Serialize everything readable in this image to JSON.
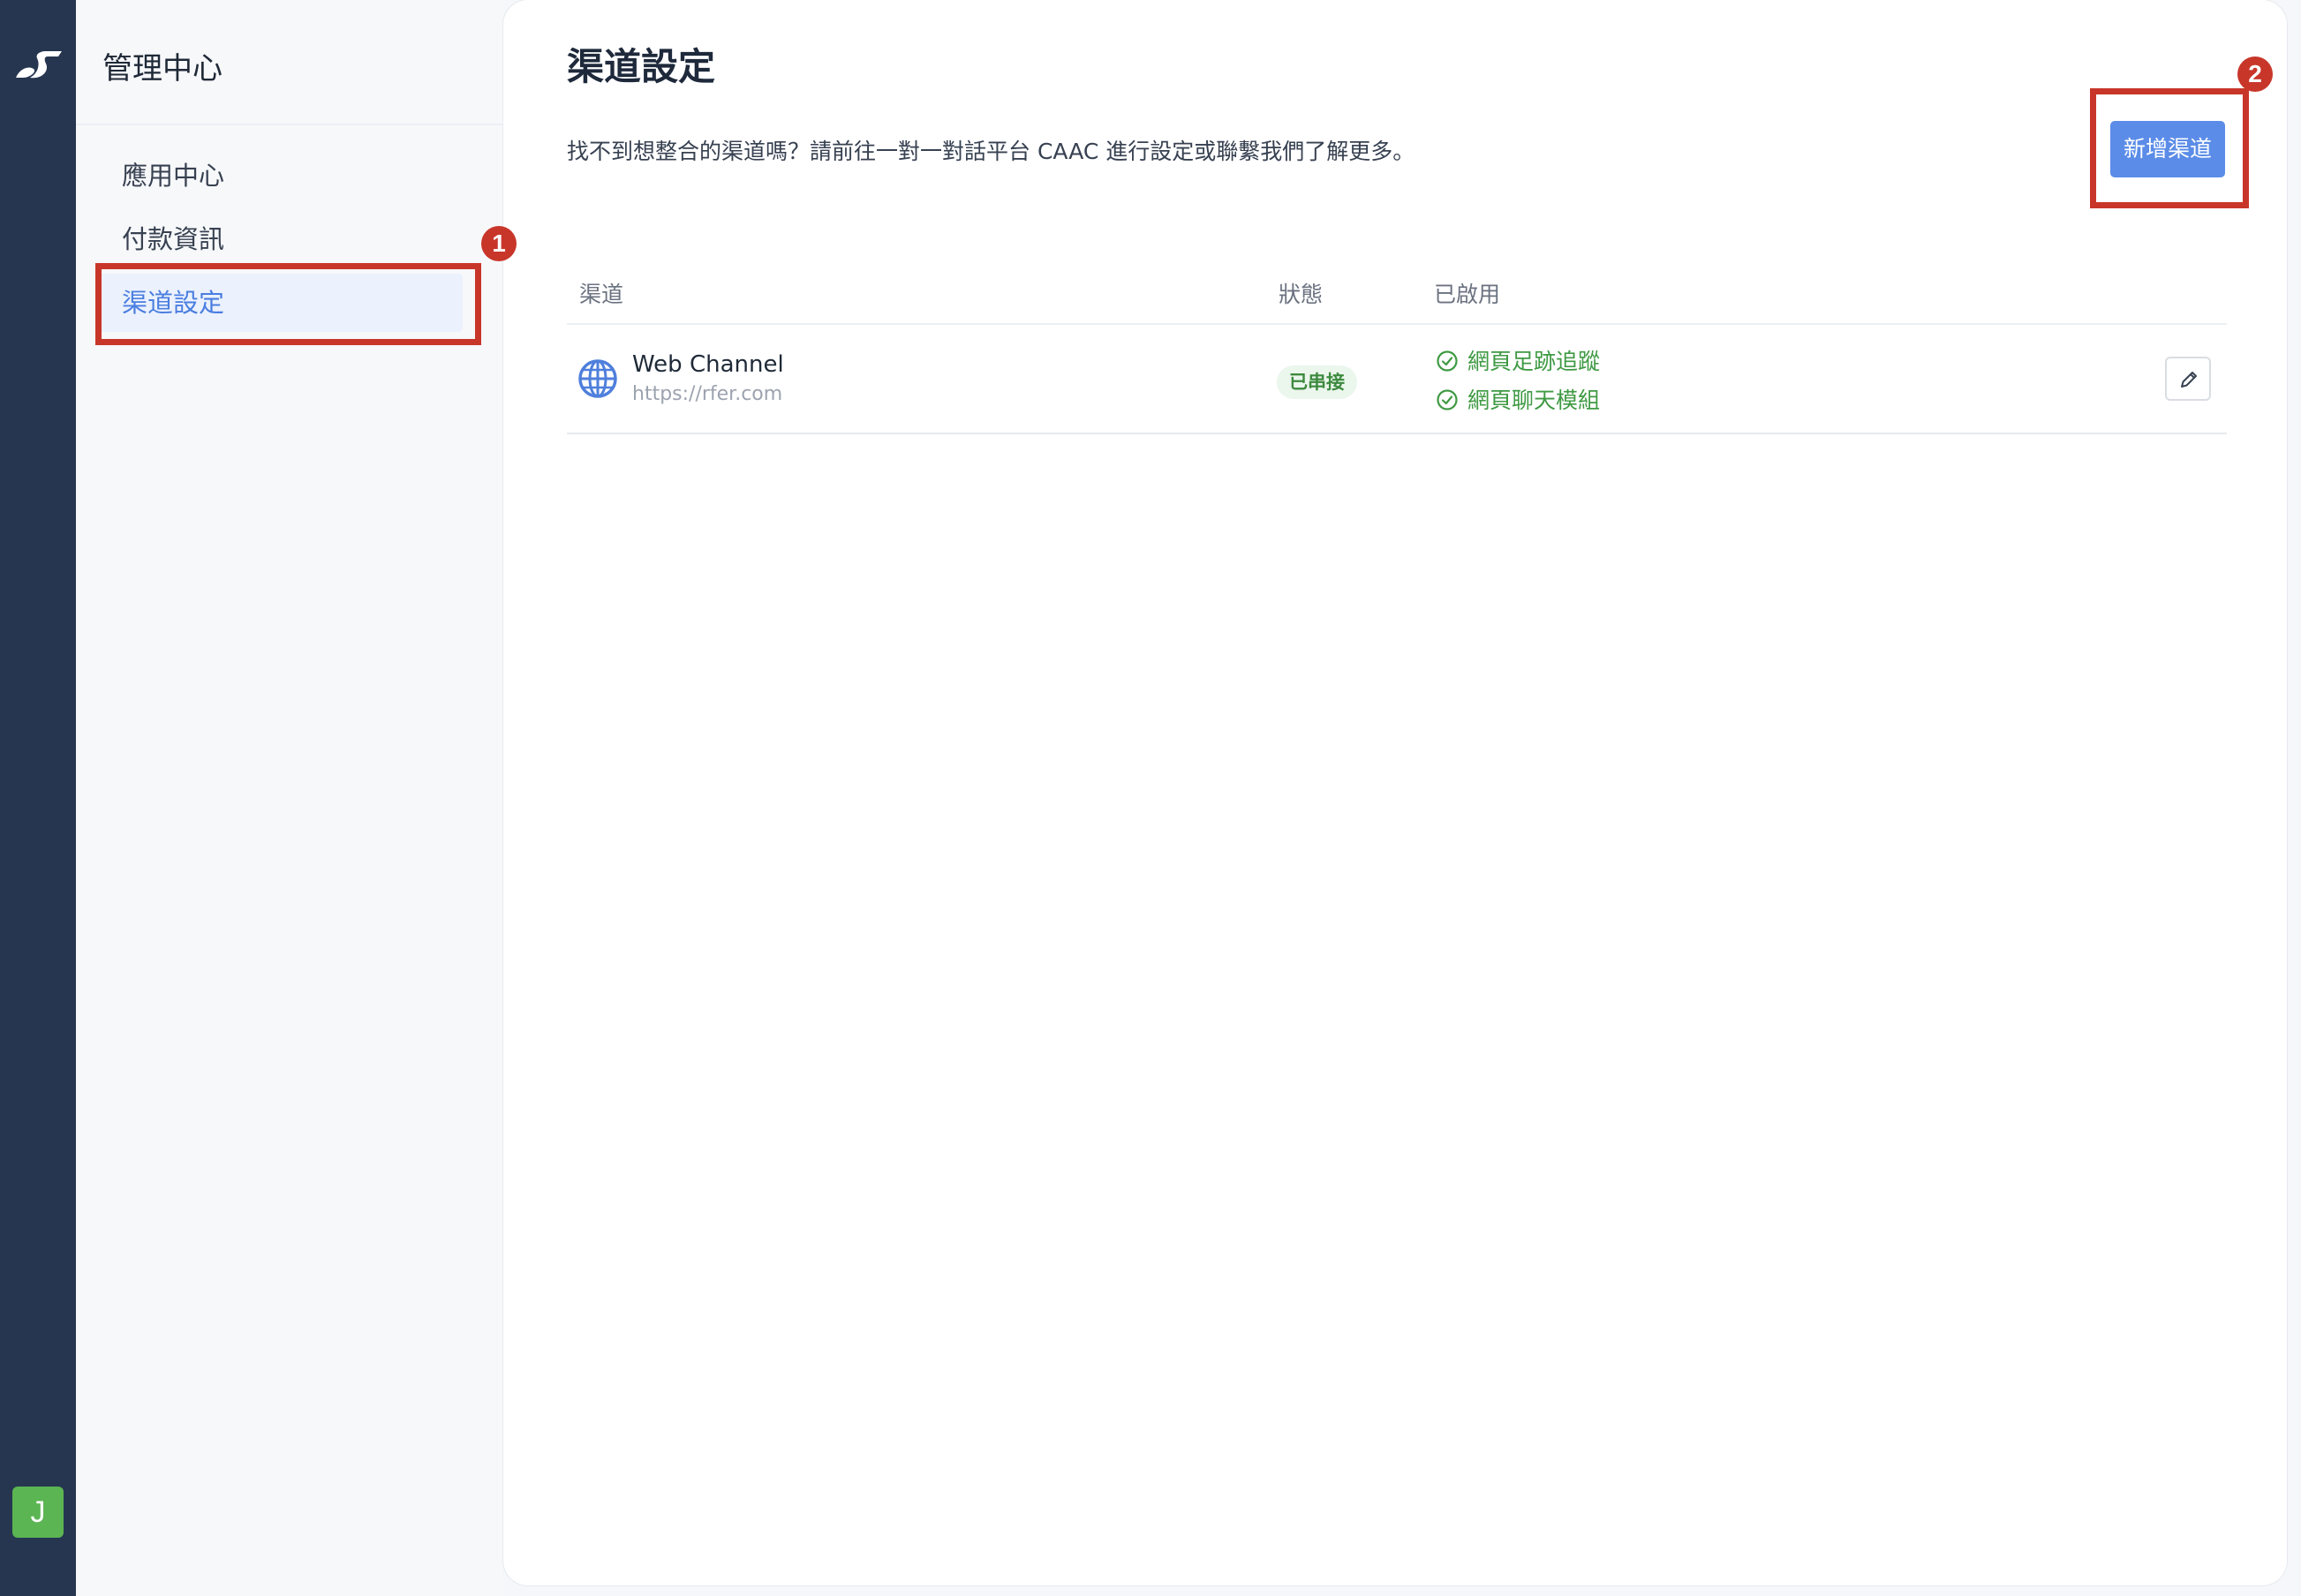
{
  "sidebar": {
    "title": "管理中心",
    "items": [
      {
        "label": "應用中心"
      },
      {
        "label": "付款資訊"
      },
      {
        "label": "渠道設定",
        "active": true
      }
    ]
  },
  "user": {
    "avatar_letter": "J",
    "avatar_color": "#5bb552"
  },
  "main": {
    "title": "渠道設定",
    "description": "找不到想整合的渠道嗎？請前往一對一對話平台 CAAC 進行設定或聯繫我們了解更多。",
    "add_button_label": "新增渠道"
  },
  "table": {
    "headers": [
      "渠道",
      "狀態",
      "已啟用"
    ],
    "rows": [
      {
        "icon": "globe-icon",
        "name": "Web Channel",
        "url": "https://rfer.com",
        "status": "已串接",
        "features": [
          "網頁足跡追蹤",
          "網頁聊天模組"
        ],
        "action_icon": "pencil-icon"
      }
    ]
  },
  "annotations": [
    {
      "number": "1"
    },
    {
      "number": "2"
    }
  ],
  "colors": {
    "rail_bg": "#263650",
    "accent": "#5b8ce8",
    "annotation_red": "#c8362a",
    "success_green": "#3f9a43"
  }
}
